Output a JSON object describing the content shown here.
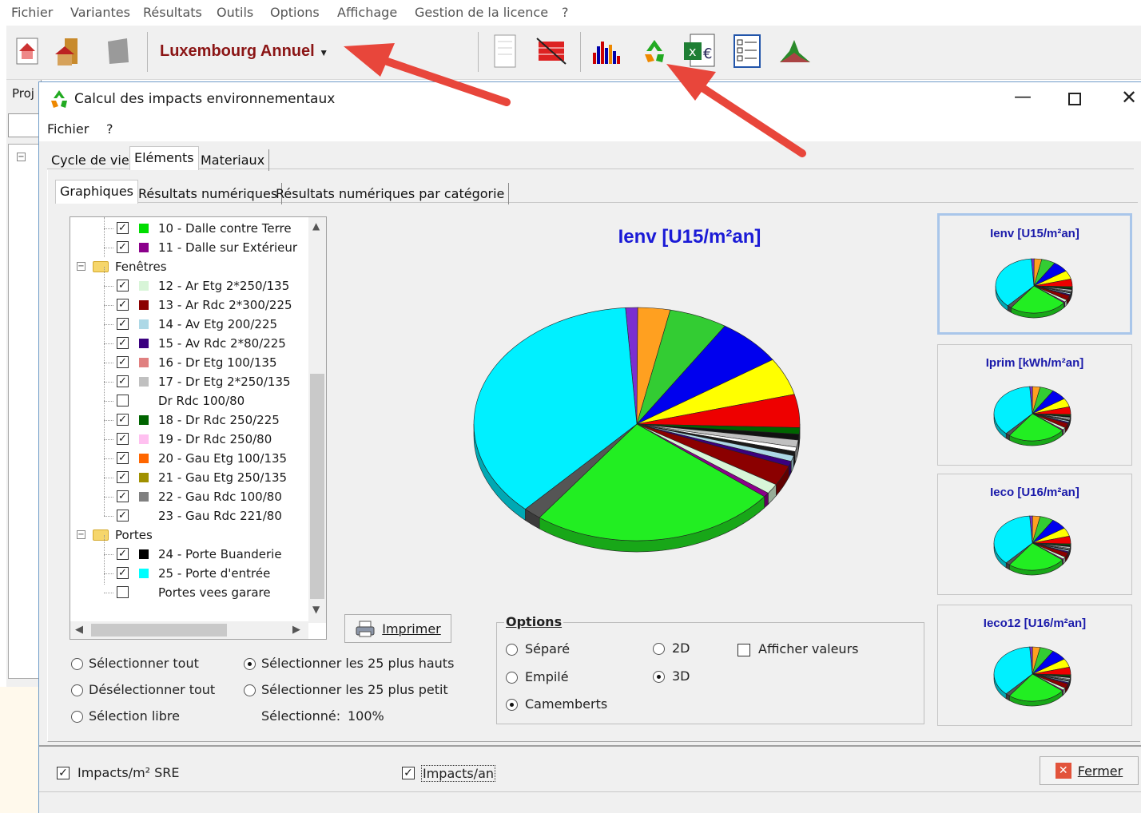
{
  "app_menu": [
    "Fichier",
    "Variantes",
    "Résultats",
    "Outils",
    "Options",
    "Affichage",
    "Gestion de la licence",
    "?"
  ],
  "toolbar": {
    "variant": "Luxembourg Annuel"
  },
  "bg_app": {
    "proj_label": "Proj"
  },
  "window": {
    "title": "Calcul des impacts environnementaux",
    "menu": [
      "Fichier",
      "?"
    ],
    "tabs": [
      "Cycle de vie",
      "Eléments",
      "Materiaux"
    ],
    "subtabs": [
      "Graphiques",
      "Résultats numériques",
      "Résultats numériques par catégorie"
    ]
  },
  "tree": {
    "items": [
      {
        "type": "item",
        "checked": true,
        "color": "#00dd00",
        "label": "10 - Dalle contre Terre"
      },
      {
        "type": "item",
        "checked": true,
        "color": "#8b008b",
        "label": "11 - Dalle sur Extérieur"
      },
      {
        "type": "folder",
        "label": "Fenêtres"
      },
      {
        "type": "item",
        "checked": true,
        "color": "#d8f5d8",
        "label": "12 - Ar Etg 2*250/135"
      },
      {
        "type": "item",
        "checked": true,
        "color": "#8b0000",
        "label": "13 - Ar Rdc 2*300/225"
      },
      {
        "type": "item",
        "checked": true,
        "color": "#add8e6",
        "label": "14 - Av Etg 200/225"
      },
      {
        "type": "item",
        "checked": true,
        "color": "#3a007f",
        "label": "15 - Av Rdc 2*80/225"
      },
      {
        "type": "item",
        "checked": true,
        "color": "#e08080",
        "label": "16 - Dr Etg 100/135"
      },
      {
        "type": "item",
        "checked": true,
        "color": "#c0c0c0",
        "label": "17 - Dr Etg 2*250/135"
      },
      {
        "type": "item",
        "checked": false,
        "color": "",
        "label": "Dr Rdc 100/80"
      },
      {
        "type": "item",
        "checked": true,
        "color": "#006400",
        "label": "18 - Dr Rdc 250/225"
      },
      {
        "type": "item",
        "checked": true,
        "color": "#ffc0f0",
        "label": "19 - Dr Rdc 250/80"
      },
      {
        "type": "item",
        "checked": true,
        "color": "#ff6600",
        "label": "20 - Gau Etg 100/135"
      },
      {
        "type": "item",
        "checked": true,
        "color": "#a09000",
        "label": "21 - Gau Etg 250/135"
      },
      {
        "type": "item",
        "checked": true,
        "color": "#808080",
        "label": "22 - Gau Rdc 100/80"
      },
      {
        "type": "item",
        "checked": true,
        "color": "",
        "label": "23 - Gau Rdc 221/80"
      },
      {
        "type": "folder",
        "label": "Portes"
      },
      {
        "type": "item",
        "checked": true,
        "color": "#000000",
        "label": "24 - Porte Buanderie"
      },
      {
        "type": "item",
        "checked": true,
        "color": "#00ffff",
        "label": "25 - Porte d'entrée"
      },
      {
        "type": "item",
        "checked": false,
        "color": "",
        "label": "Portes vees garare"
      }
    ]
  },
  "print_button": "Imprimer",
  "selection": {
    "select_all": "Sélectionner tout",
    "deselect_all": "Désélectionner tout",
    "free": "Sélection libre",
    "top25": "Sélectionner les 25 plus hauts",
    "bottom25": "Sélectionner les 25 plus petit",
    "selected_label": "Sélectionné:",
    "selected_value": "100%"
  },
  "options": {
    "title": "Options",
    "separe": "Séparé",
    "empile": "Empilé",
    "camemberts": "Camemberts",
    "d2": "2D",
    "d3": "3D",
    "show_values": "Afficher valeurs"
  },
  "chart_data": {
    "type": "pie",
    "title": "Ienv [U15/m²an]",
    "style": "3D",
    "slices_approx_percent": [
      {
        "color": "#7b2fd0",
        "value": 1.2
      },
      {
        "color": "#ffa020",
        "value": 3.2
      },
      {
        "color": "#33cc33",
        "value": 5.8
      },
      {
        "color": "#0000ee",
        "value": 6.6
      },
      {
        "color": "#ffff00",
        "value": 5.2
      },
      {
        "color": "#ee0000",
        "value": 4.6
      },
      {
        "color": "#006400",
        "value": 0.9
      },
      {
        "color": "#111111",
        "value": 0.8
      },
      {
        "color": "#c0c0c0",
        "value": 1.0
      },
      {
        "color": "#ffffff",
        "value": 0.6
      },
      {
        "color": "#1a1a1a",
        "value": 0.6
      },
      {
        "color": "#add8e6",
        "value": 0.8
      },
      {
        "color": "#3a007f",
        "value": 0.7
      },
      {
        "color": "#8b0000",
        "value": 2.8
      },
      {
        "color": "#d8f5d8",
        "value": 1.4
      },
      {
        "color": "#8b008b",
        "value": 0.6
      },
      {
        "color": "#22ee22",
        "value": 24.5
      },
      {
        "color": "#555555",
        "value": 1.8
      },
      {
        "color": "#00f0ff",
        "value": 36.9
      }
    ]
  },
  "thumbnails": [
    "Ienv [U15/m²an]",
    "Iprim [kWh/m²an]",
    "Ieco [U16/m²an]",
    "Ieco12 [U16/m²an]"
  ],
  "footer": {
    "impacts_sre": "Impacts/m² SRE",
    "impacts_an": "Impacts/an",
    "close": "Fermer"
  }
}
